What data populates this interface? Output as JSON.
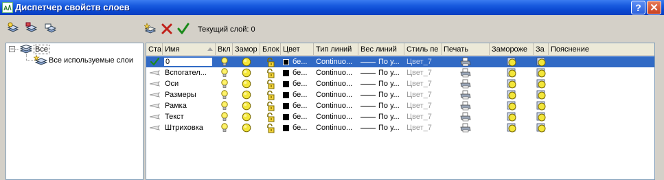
{
  "window": {
    "title": "Диспетчер свойств слоев"
  },
  "titlebar": {
    "help_label": "?",
    "close_label": "✕"
  },
  "toolbar": {
    "left_icons": [
      "new-property-filter-icon",
      "new-group-filter-icon",
      "layer-states-manager-icon"
    ],
    "right_icons": [
      "new-layer-icon",
      "delete-layer-icon",
      "set-current-icon"
    ],
    "current_layer_text": "Текущий слой: 0"
  },
  "tree": {
    "root_label": "Все",
    "root_expander": "−",
    "child_label": "Все используемые слои"
  },
  "columns": [
    {
      "key": "status",
      "label": "Ста"
    },
    {
      "key": "name",
      "label": "Имя"
    },
    {
      "key": "on",
      "label": "Вкл"
    },
    {
      "key": "freeze",
      "label": "Замор"
    },
    {
      "key": "lock",
      "label": "Блок"
    },
    {
      "key": "color",
      "label": "Цвет"
    },
    {
      "key": "linetype",
      "label": "Тип линий"
    },
    {
      "key": "lineweight",
      "label": "Вес линий"
    },
    {
      "key": "plotstyle",
      "label": "Стиль пе"
    },
    {
      "key": "plot",
      "label": "Печать"
    },
    {
      "key": "vpfreeze",
      "label": "Замороже"
    },
    {
      "key": "newvpfreeze",
      "label": "За"
    },
    {
      "key": "description",
      "label": "Пояснение"
    }
  ],
  "layers": [
    {
      "name": "0",
      "current": true,
      "color": "бе...",
      "linetype": "Continuo...",
      "lineweight": "По у...",
      "plotstyle": "Цвет_7"
    },
    {
      "name": "Вспогател...",
      "current": false,
      "color": "бе...",
      "linetype": "Continuo...",
      "lineweight": "По у...",
      "plotstyle": "Цвет_7"
    },
    {
      "name": "Оси",
      "current": false,
      "color": "бе...",
      "linetype": "Continuo...",
      "lineweight": "По у...",
      "plotstyle": "Цвет_7"
    },
    {
      "name": "Размеры",
      "current": false,
      "color": "бе...",
      "linetype": "Continuo...",
      "lineweight": "По у...",
      "plotstyle": "Цвет_7"
    },
    {
      "name": "Рамка",
      "current": false,
      "color": "бе...",
      "linetype": "Continuo...",
      "lineweight": "По у...",
      "plotstyle": "Цвет_7"
    },
    {
      "name": "Текст",
      "current": false,
      "color": "бе...",
      "linetype": "Continuo...",
      "lineweight": "По у...",
      "plotstyle": "Цвет_7"
    },
    {
      "name": "Штриховка",
      "current": false,
      "color": "бе...",
      "linetype": "Continuo...",
      "lineweight": "По у...",
      "plotstyle": "Цвет_7"
    }
  ],
  "colors": {
    "selection": "#316ac5",
    "title_bar": "#0a47d0"
  }
}
